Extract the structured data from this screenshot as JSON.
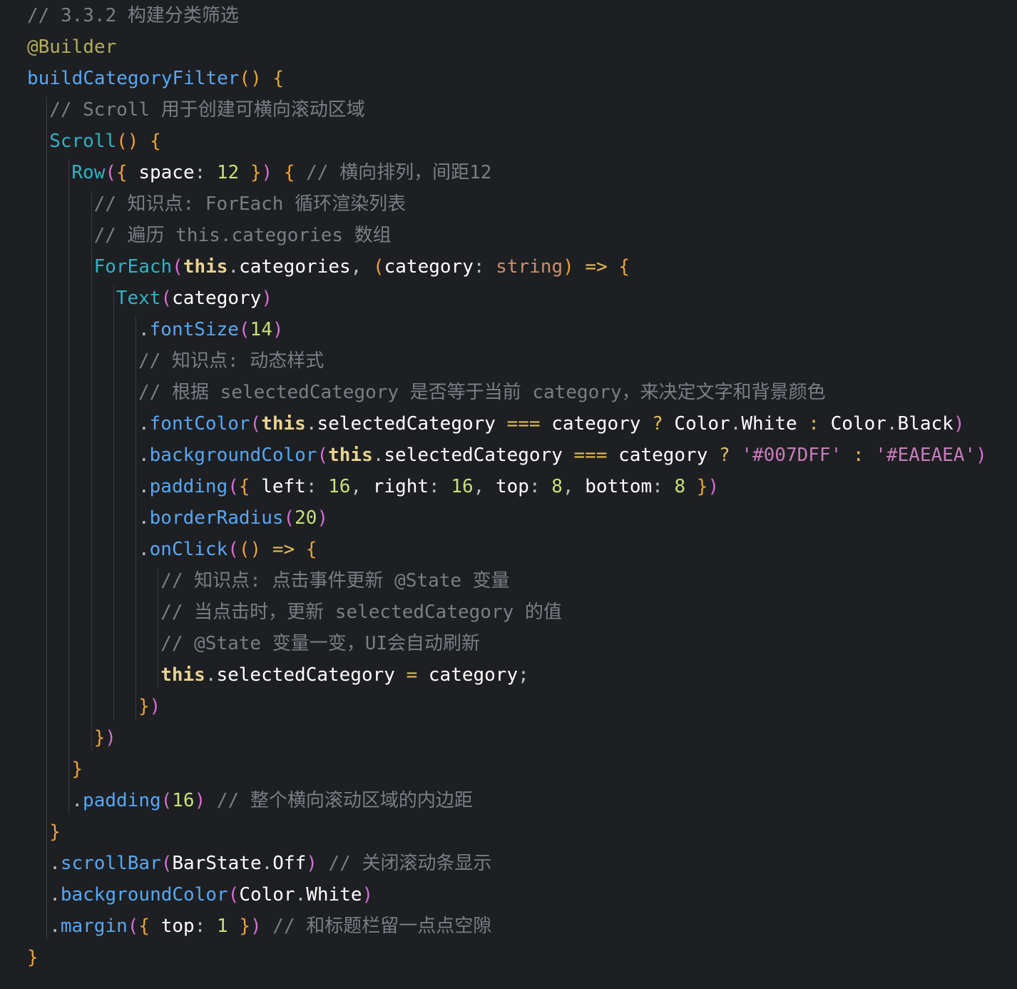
{
  "editor": {
    "background": "#1e1f22",
    "lines": [
      {
        "indent": 0,
        "tokens": [
          {
            "t": "// 3.3.2 构建分类筛选",
            "c": "comment"
          }
        ]
      },
      {
        "indent": 0,
        "tokens": [
          {
            "t": "@Builder",
            "c": "ann"
          }
        ]
      },
      {
        "indent": 0,
        "tokens": [
          {
            "t": "buildCategoryFilter",
            "c": "func"
          },
          {
            "t": "()",
            "c": "br1"
          },
          {
            "t": " ",
            "c": "plain"
          },
          {
            "t": "{",
            "c": "br1"
          }
        ]
      },
      {
        "indent": 1,
        "tokens": [
          {
            "t": "// Scroll 用于创建可横向滚动区域",
            "c": "comment"
          }
        ]
      },
      {
        "indent": 1,
        "tokens": [
          {
            "t": "Scroll",
            "c": "comp"
          },
          {
            "t": "()",
            "c": "br1"
          },
          {
            "t": " ",
            "c": "plain"
          },
          {
            "t": "{",
            "c": "br1"
          }
        ]
      },
      {
        "indent": 2,
        "tokens": [
          {
            "t": "Row",
            "c": "comp"
          },
          {
            "t": "(",
            "c": "br2"
          },
          {
            "t": "{",
            "c": "br1"
          },
          {
            "t": " space",
            "c": "prop"
          },
          {
            "t": ": ",
            "c": "punc"
          },
          {
            "t": "12",
            "c": "num"
          },
          {
            "t": " ",
            "c": "plain"
          },
          {
            "t": "}",
            "c": "br1"
          },
          {
            "t": ")",
            "c": "br2"
          },
          {
            "t": " ",
            "c": "plain"
          },
          {
            "t": "{",
            "c": "br1"
          },
          {
            "t": " // 横向排列，间距12",
            "c": "comment"
          }
        ]
      },
      {
        "indent": 3,
        "tokens": [
          {
            "t": "// 知识点: ForEach 循环渲染列表",
            "c": "comment"
          }
        ]
      },
      {
        "indent": 3,
        "tokens": [
          {
            "t": "// 遍历 this.categories 数组",
            "c": "comment"
          }
        ]
      },
      {
        "indent": 3,
        "tokens": [
          {
            "t": "ForEach",
            "c": "comp"
          },
          {
            "t": "(",
            "c": "br2"
          },
          {
            "t": "this",
            "c": "kw"
          },
          {
            "t": ".",
            "c": "punc"
          },
          {
            "t": "categories",
            "c": "plain"
          },
          {
            "t": ", ",
            "c": "punc"
          },
          {
            "t": "(",
            "c": "br1"
          },
          {
            "t": "category",
            "c": "plain"
          },
          {
            "t": ": ",
            "c": "punc"
          },
          {
            "t": "string",
            "c": "type"
          },
          {
            "t": ")",
            "c": "br1"
          },
          {
            "t": " => ",
            "c": "op"
          },
          {
            "t": "{",
            "c": "br1"
          }
        ]
      },
      {
        "indent": 4,
        "tokens": [
          {
            "t": "Text",
            "c": "comp"
          },
          {
            "t": "(",
            "c": "br2"
          },
          {
            "t": "category",
            "c": "plain"
          },
          {
            "t": ")",
            "c": "br2"
          }
        ]
      },
      {
        "indent": 5,
        "tokens": [
          {
            "t": ".",
            "c": "punc"
          },
          {
            "t": "fontSize",
            "c": "func"
          },
          {
            "t": "(",
            "c": "br2"
          },
          {
            "t": "14",
            "c": "num"
          },
          {
            "t": ")",
            "c": "br2"
          }
        ]
      },
      {
        "indent": 5,
        "tokens": [
          {
            "t": "// 知识点: 动态样式",
            "c": "comment"
          }
        ]
      },
      {
        "indent": 5,
        "tokens": [
          {
            "t": "// 根据 selectedCategory 是否等于当前 category，来决定文字和背景颜色",
            "c": "comment"
          }
        ]
      },
      {
        "indent": 5,
        "tokens": [
          {
            "t": ".",
            "c": "punc"
          },
          {
            "t": "fontColor",
            "c": "func"
          },
          {
            "t": "(",
            "c": "br2"
          },
          {
            "t": "this",
            "c": "kw"
          },
          {
            "t": ".",
            "c": "punc"
          },
          {
            "t": "selectedCategory",
            "c": "plain"
          },
          {
            "t": " === ",
            "c": "op"
          },
          {
            "t": "category",
            "c": "plain"
          },
          {
            "t": " ? ",
            "c": "op"
          },
          {
            "t": "Color",
            "c": "plain"
          },
          {
            "t": ".",
            "c": "punc"
          },
          {
            "t": "White",
            "c": "plain"
          },
          {
            "t": " : ",
            "c": "op"
          },
          {
            "t": "Color",
            "c": "plain"
          },
          {
            "t": ".",
            "c": "punc"
          },
          {
            "t": "Black",
            "c": "plain"
          },
          {
            "t": ")",
            "c": "br2"
          }
        ]
      },
      {
        "indent": 5,
        "tokens": [
          {
            "t": ".",
            "c": "punc"
          },
          {
            "t": "backgroundColor",
            "c": "func"
          },
          {
            "t": "(",
            "c": "br2"
          },
          {
            "t": "this",
            "c": "kw"
          },
          {
            "t": ".",
            "c": "punc"
          },
          {
            "t": "selectedCategory",
            "c": "plain"
          },
          {
            "t": " === ",
            "c": "op"
          },
          {
            "t": "category",
            "c": "plain"
          },
          {
            "t": " ? ",
            "c": "op"
          },
          {
            "t": "'#007DFF'",
            "c": "str"
          },
          {
            "t": " : ",
            "c": "op"
          },
          {
            "t": "'#EAEAEA'",
            "c": "str"
          },
          {
            "t": ")",
            "c": "br2"
          }
        ]
      },
      {
        "indent": 5,
        "tokens": [
          {
            "t": ".",
            "c": "punc"
          },
          {
            "t": "padding",
            "c": "func"
          },
          {
            "t": "(",
            "c": "br2"
          },
          {
            "t": "{",
            "c": "br1"
          },
          {
            "t": " left",
            "c": "prop"
          },
          {
            "t": ": ",
            "c": "punc"
          },
          {
            "t": "16",
            "c": "num"
          },
          {
            "t": ", ",
            "c": "punc"
          },
          {
            "t": "right",
            "c": "prop"
          },
          {
            "t": ": ",
            "c": "punc"
          },
          {
            "t": "16",
            "c": "num"
          },
          {
            "t": ", ",
            "c": "punc"
          },
          {
            "t": "top",
            "c": "prop"
          },
          {
            "t": ": ",
            "c": "punc"
          },
          {
            "t": "8",
            "c": "num"
          },
          {
            "t": ", ",
            "c": "punc"
          },
          {
            "t": "bottom",
            "c": "prop"
          },
          {
            "t": ": ",
            "c": "punc"
          },
          {
            "t": "8",
            "c": "num"
          },
          {
            "t": " ",
            "c": "plain"
          },
          {
            "t": "}",
            "c": "br1"
          },
          {
            "t": ")",
            "c": "br2"
          }
        ]
      },
      {
        "indent": 5,
        "tokens": [
          {
            "t": ".",
            "c": "punc"
          },
          {
            "t": "borderRadius",
            "c": "func"
          },
          {
            "t": "(",
            "c": "br2"
          },
          {
            "t": "20",
            "c": "num"
          },
          {
            "t": ")",
            "c": "br2"
          }
        ]
      },
      {
        "indent": 5,
        "tokens": [
          {
            "t": ".",
            "c": "punc"
          },
          {
            "t": "onClick",
            "c": "func"
          },
          {
            "t": "(",
            "c": "br2"
          },
          {
            "t": "()",
            "c": "br1"
          },
          {
            "t": " => ",
            "c": "op"
          },
          {
            "t": "{",
            "c": "br1"
          }
        ]
      },
      {
        "indent": 6,
        "tokens": [
          {
            "t": "// 知识点: 点击事件更新 @State 变量",
            "c": "comment"
          }
        ]
      },
      {
        "indent": 6,
        "tokens": [
          {
            "t": "// 当点击时，更新 selectedCategory 的值",
            "c": "comment"
          }
        ]
      },
      {
        "indent": 6,
        "tokens": [
          {
            "t": "// @State 变量一变，UI会自动刷新",
            "c": "comment"
          }
        ]
      },
      {
        "indent": 6,
        "tokens": [
          {
            "t": "this",
            "c": "kw"
          },
          {
            "t": ".",
            "c": "punc"
          },
          {
            "t": "selectedCategory",
            "c": "plain"
          },
          {
            "t": " = ",
            "c": "op"
          },
          {
            "t": "category",
            "c": "plain"
          },
          {
            "t": ";",
            "c": "punc"
          }
        ]
      },
      {
        "indent": 5,
        "tokens": [
          {
            "t": "}",
            "c": "br1"
          },
          {
            "t": ")",
            "c": "br2"
          }
        ]
      },
      {
        "indent": 3,
        "tokens": [
          {
            "t": "}",
            "c": "br1"
          },
          {
            "t": ")",
            "c": "br2"
          }
        ]
      },
      {
        "indent": 2,
        "tokens": [
          {
            "t": "}",
            "c": "br1"
          }
        ]
      },
      {
        "indent": 2,
        "tokens": [
          {
            "t": ".",
            "c": "punc"
          },
          {
            "t": "padding",
            "c": "func"
          },
          {
            "t": "(",
            "c": "br2"
          },
          {
            "t": "16",
            "c": "num"
          },
          {
            "t": ")",
            "c": "br2"
          },
          {
            "t": " // 整个横向滚动区域的内边距",
            "c": "comment"
          }
        ]
      },
      {
        "indent": 1,
        "tokens": [
          {
            "t": "}",
            "c": "br1"
          }
        ]
      },
      {
        "indent": 1,
        "tokens": [
          {
            "t": ".",
            "c": "punc"
          },
          {
            "t": "scrollBar",
            "c": "func"
          },
          {
            "t": "(",
            "c": "br2"
          },
          {
            "t": "BarState",
            "c": "plain"
          },
          {
            "t": ".",
            "c": "punc"
          },
          {
            "t": "Off",
            "c": "plain"
          },
          {
            "t": ")",
            "c": "br2"
          },
          {
            "t": " // 关闭滚动条显示",
            "c": "comment"
          }
        ]
      },
      {
        "indent": 1,
        "tokens": [
          {
            "t": ".",
            "c": "punc"
          },
          {
            "t": "backgroundColor",
            "c": "func"
          },
          {
            "t": "(",
            "c": "br2"
          },
          {
            "t": "Color",
            "c": "plain"
          },
          {
            "t": ".",
            "c": "punc"
          },
          {
            "t": "White",
            "c": "plain"
          },
          {
            "t": ")",
            "c": "br2"
          }
        ]
      },
      {
        "indent": 1,
        "tokens": [
          {
            "t": ".",
            "c": "punc"
          },
          {
            "t": "margin",
            "c": "func"
          },
          {
            "t": "(",
            "c": "br2"
          },
          {
            "t": "{",
            "c": "br1"
          },
          {
            "t": " top",
            "c": "prop"
          },
          {
            "t": ": ",
            "c": "punc"
          },
          {
            "t": "1",
            "c": "num"
          },
          {
            "t": " ",
            "c": "plain"
          },
          {
            "t": "}",
            "c": "br1"
          },
          {
            "t": ")",
            "c": "br2"
          },
          {
            "t": " // 和标题栏留一点点空隙",
            "c": "comment"
          }
        ]
      },
      {
        "indent": 0,
        "tokens": [
          {
            "t": "}",
            "c": "br1"
          }
        ]
      }
    ]
  }
}
